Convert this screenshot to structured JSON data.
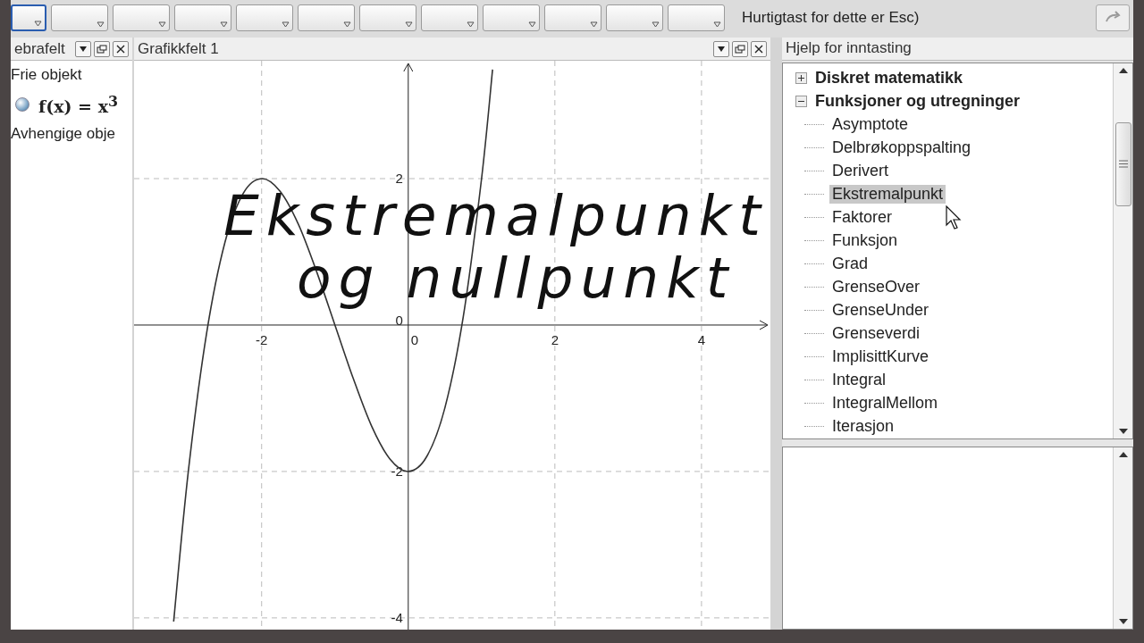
{
  "toolbar": {
    "tools": [
      {
        "selected": true
      },
      {
        "selected": false
      },
      {
        "selected": false
      },
      {
        "selected": false
      },
      {
        "selected": false
      },
      {
        "selected": false
      },
      {
        "selected": false
      },
      {
        "selected": false
      },
      {
        "selected": false
      },
      {
        "selected": false
      },
      {
        "selected": false
      },
      {
        "selected": false
      }
    ],
    "hint": "Hurtigtast for dette er Esc)"
  },
  "algebra": {
    "title": "ebrafelt",
    "sections": [
      {
        "heading": "Frie objekt",
        "items": [
          {
            "formula": "f(x) = x$^{3}$",
            "visible": true
          }
        ]
      },
      {
        "heading": "Avhengige obje"
      }
    ]
  },
  "graphics": {
    "title": "Grafikkfelt 1",
    "chart_data": {
      "type": "line",
      "x": [
        -3.2,
        -3,
        -2.75,
        -2.5,
        -2.25,
        -2,
        -1.75,
        -1.5,
        -1.25,
        -1,
        -0.75,
        -0.5,
        -0.25,
        0,
        0.25,
        0.5,
        0.75,
        1,
        1.15
      ],
      "series": [
        {
          "color": "#333333",
          "values": [
            -4.05,
            -2,
            -0.11,
            1.13,
            1.8,
            2,
            1.83,
            1.38,
            0.73,
            0,
            -0.73,
            -1.38,
            -1.83,
            -2,
            -1.8,
            -1.13,
            0.11,
            2,
            3.49
          ]
        }
      ],
      "xlim": [
        -3.74,
        4.94
      ],
      "ylim": [
        -4.16,
        3.61
      ],
      "grid": true,
      "xticks": [
        -2,
        0,
        2,
        4
      ],
      "yticks": [
        -4,
        -2,
        0,
        2
      ]
    }
  },
  "help": {
    "title": "Hjelp for inntasting",
    "tree": [
      {
        "label": "Diskret matematikk",
        "expanded": false
      },
      {
        "label": "Funksjoner og utregninger",
        "expanded": true,
        "children": [
          {
            "label": "Asymptote",
            "selected": false
          },
          {
            "label": "Delbrøkoppspalting",
            "selected": false
          },
          {
            "label": "Derivert",
            "selected": false
          },
          {
            "label": "Ekstremalpunkt",
            "selected": true
          },
          {
            "label": "Faktorer",
            "selected": false
          },
          {
            "label": "Funksjon",
            "selected": false
          },
          {
            "label": "Grad",
            "selected": false
          },
          {
            "label": "GrenseOver",
            "selected": false
          },
          {
            "label": "GrenseUnder",
            "selected": false
          },
          {
            "label": "Grenseverdi",
            "selected": false
          },
          {
            "label": "ImplisittKurve",
            "selected": false
          },
          {
            "label": "Integral",
            "selected": false
          },
          {
            "label": "IntegralMellom",
            "selected": false
          },
          {
            "label": "Iterasjon",
            "selected": false
          }
        ]
      }
    ]
  },
  "overlay": {
    "lines": [
      "Ekstremalpunkt",
      "og nullpunkt"
    ]
  }
}
